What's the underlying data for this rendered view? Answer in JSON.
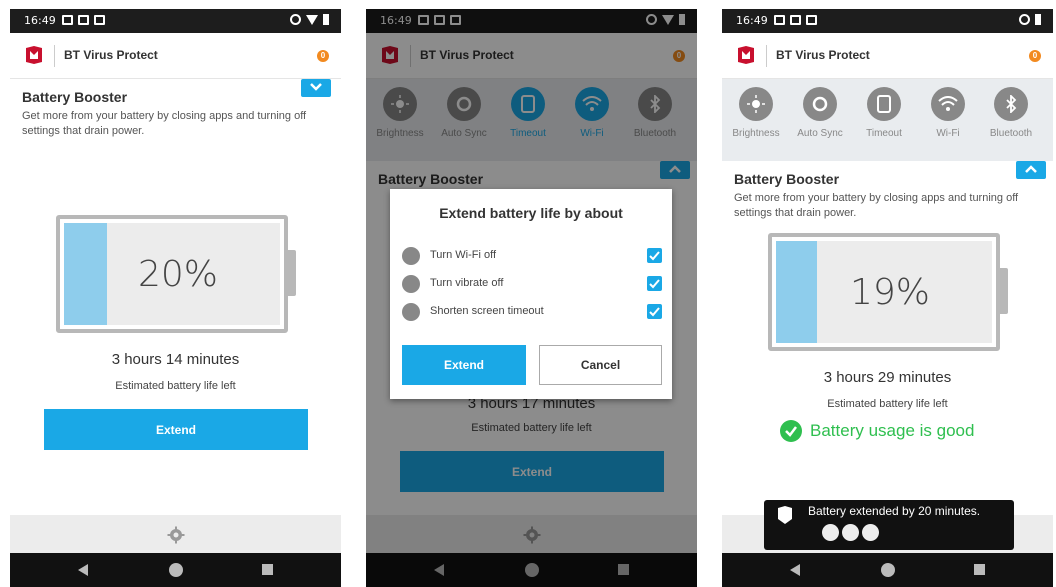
{
  "status_time": "16:49",
  "app_title": "BT Virus Protect",
  "notif_count": "0",
  "colors": {
    "accent": "#1aa8e6",
    "brand_red": "#c8102e",
    "good_green": "#2fbf4f",
    "battery_fill": "#8ecdec"
  },
  "quick_settings": [
    {
      "label": "Brightness",
      "icon": "brightness-icon"
    },
    {
      "label": "Auto Sync",
      "icon": "sync-icon"
    },
    {
      "label": "Timeout",
      "icon": "timeout-icon"
    },
    {
      "label": "Wi-Fi",
      "icon": "wifi-icon"
    },
    {
      "label": "Bluetooth",
      "icon": "bluetooth-icon"
    }
  ],
  "screen1": {
    "section_title": "Battery Booster",
    "section_desc": "Get more from your battery by closing apps and turning off settings that drain power.",
    "battery_pct": "20%",
    "battery_level": 0.2,
    "time_left": "3 hours 14 minutes",
    "time_caption": "Estimated battery life left",
    "extend_label": "Extend"
  },
  "screen2": {
    "section_title": "Battery Booster",
    "time_left": "3 hours 17 minutes",
    "time_caption": "Estimated battery life left",
    "extend_label": "Extend",
    "dialog": {
      "title": "Extend battery life by about",
      "options": [
        {
          "label": "Turn Wi-Fi off",
          "icon": "wifi-icon",
          "checked": true
        },
        {
          "label": "Turn vibrate off",
          "icon": "vibrate-icon",
          "checked": true
        },
        {
          "label": "Shorten screen timeout",
          "icon": "timeout-icon",
          "checked": true
        }
      ],
      "extend_label": "Extend",
      "cancel_label": "Cancel"
    }
  },
  "screen3": {
    "section_title": "Battery Booster",
    "section_desc": "Get more from your battery by closing apps and turning off settings that drain power.",
    "battery_pct": "19%",
    "battery_level": 0.19,
    "time_left": "3 hours 29 minutes",
    "time_caption": "Estimated battery life left",
    "good_text": "Battery usage is good",
    "toast_text": "Battery extended by 20 minutes."
  }
}
